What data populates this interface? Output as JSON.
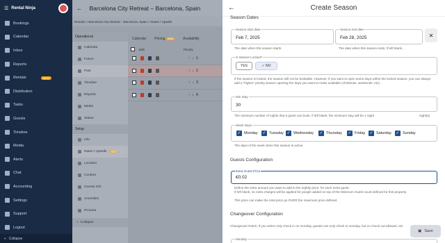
{
  "nav": {
    "brand": "Rental Ninja",
    "items": [
      {
        "label": "Bookings",
        "icon": "bookings-icon"
      },
      {
        "label": "Calendar",
        "icon": "calendar-icon"
      },
      {
        "label": "Inbox",
        "icon": "inbox-icon"
      },
      {
        "label": "Reports",
        "icon": "reports-icon"
      },
      {
        "label": "Rentals",
        "icon": "rentals-icon",
        "badge": "NEW"
      },
      {
        "label": "Distribution",
        "icon": "distribution-icon"
      },
      {
        "label": "Tasks",
        "icon": "tasks-icon"
      },
      {
        "label": "Guests",
        "icon": "guests-icon"
      },
      {
        "label": "Timeline",
        "icon": "timeline-icon"
      },
      {
        "label": "Media",
        "icon": "media-icon"
      },
      {
        "label": "Alerts",
        "icon": "alerts-icon"
      },
      {
        "label": "Chat",
        "icon": "chat-icon"
      },
      {
        "label": "Accounting",
        "icon": "accounting-icon"
      },
      {
        "label": "Settings",
        "icon": "settings-icon"
      },
      {
        "label": "Support",
        "icon": "support-icon"
      },
      {
        "label": "Logout",
        "icon": "logout-icon"
      }
    ],
    "collapse": "Collapse"
  },
  "main": {
    "title": "Barcelona City Retreat – Barcelona, Spain",
    "breadcrumb": "Rentals  >  Barcelona City Retreat – Barcelona, Spain  >  Rates / Upsells",
    "sub": {
      "operational": "Operational",
      "items": [
        "Calendar",
        "Future",
        "Past",
        "Timeline",
        "Reports",
        "Media",
        "Status"
      ],
      "setup": "Setup",
      "setup_items": [
        "Info",
        "Rates / Upsells",
        "Location",
        "Content",
        "Guests Info",
        "Amenities",
        "Pictures"
      ],
      "setup_badge": "NEW",
      "collapse": "Collapse"
    },
    "tabs": [
      {
        "label": "Calendar"
      },
      {
        "label": "Pricing",
        "badge": "NEW"
      },
      {
        "label": "Availability"
      }
    ],
    "table": {
      "col_edit": "Edit",
      "col_priority": "Priority",
      "rows": [
        "1",
        "2",
        "3",
        "4"
      ]
    }
  },
  "panel": {
    "title": "Create Season",
    "season_dates": "Season Dates",
    "start": {
      "label": "Season start date",
      "value": "Feb 7, 2025",
      "helper": "The date when this season starts"
    },
    "end": {
      "label": "Season end date",
      "value": "Feb 28, 2025",
      "helper": "The date when this season ends. If left blank..."
    },
    "locked": {
      "label": "Is Season Locked?",
      "yes": "YES",
      "no": "NO",
      "helper": "If the season is locked, the season will not be bookable. However, if you want to open some days within the locked season, you can always add a \"higher\" priority season opening the days you want to make available (christmas, weekends, etc)."
    },
    "minstay": {
      "label": "Min Stay",
      "value": "30",
      "helper": "The minimum number of nights that a guest can book. If left blank, the minimum stay will be 1 night",
      "helper_right": "night(s)"
    },
    "weekdays": {
      "label": "Week Days",
      "days": [
        "Monday",
        "Tuesday",
        "Wednesday",
        "Thursday",
        "Friday",
        "Saturday",
        "Sunday"
      ],
      "helper": "The days of the week when this season is active."
    },
    "guests_config": "Guests Configuration",
    "extra": {
      "label": "Extra Guest Price",
      "value": "€0.02",
      "helper1": "Define the extra amount you want to add to the nightly price, for each extra guest.",
      "helper2": "If left blank, no extra charges will be applied for people added on top of the Minimum Guest count defined for this property.",
      "helper3": "This price can make the total price go OVER the maximum price defined."
    },
    "changeover": "Changeover Configuration",
    "changeover_helper": "Changeover Rules. If you select only check in on monday, guests can only check in monday, but no check out allowed, etc.",
    "cut_label": "Monday",
    "save": "Save"
  }
}
